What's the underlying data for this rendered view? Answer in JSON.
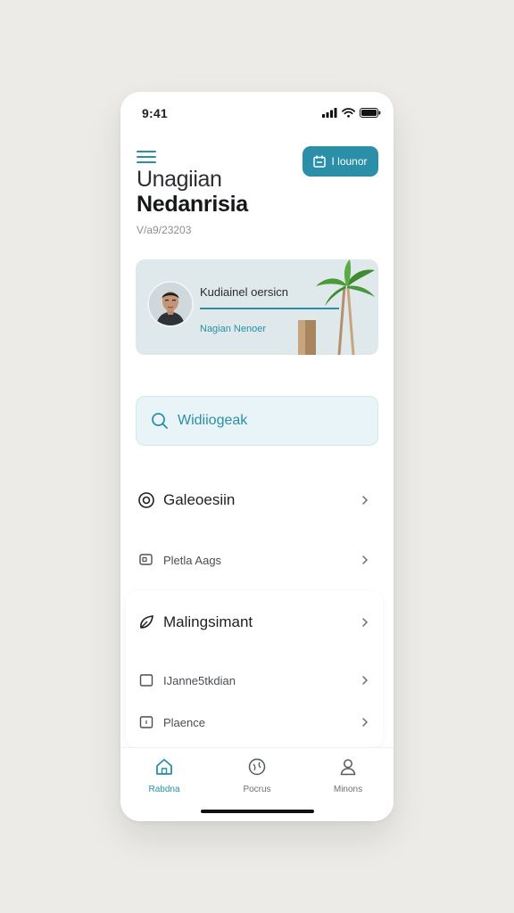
{
  "status_bar": {
    "time": "9:41"
  },
  "header": {
    "button_label": "I lounor",
    "title_line1": "Unagiian",
    "title_line2": "Nedanrisia",
    "subtitle": "V/a9/23203"
  },
  "profile": {
    "name": "Kudiainel oersicn",
    "subtitle": "Nagian Nenoer"
  },
  "search": {
    "placeholder": "Widiiogeak"
  },
  "menu": {
    "items": [
      {
        "label": "Galeoesiin",
        "icon": "shield-icon"
      },
      {
        "label": "Pletla Aags",
        "icon": "chat-icon"
      },
      {
        "label": "Malingsimant",
        "icon": "leaf-icon"
      },
      {
        "label": "IJanne5tkdian",
        "icon": "square-icon"
      },
      {
        "label": "Plaence",
        "icon": "tag-icon"
      }
    ]
  },
  "tabs": [
    {
      "label": "Rabdna",
      "icon": "home-icon",
      "active": true
    },
    {
      "label": "Pocrus",
      "icon": "globe-icon",
      "active": false
    },
    {
      "label": "Minons",
      "icon": "user-icon",
      "active": false
    }
  ],
  "colors": {
    "accent": "#2a8fa7",
    "card_bg": "#dfe8ea",
    "search_bg": "#e8f4f8"
  }
}
